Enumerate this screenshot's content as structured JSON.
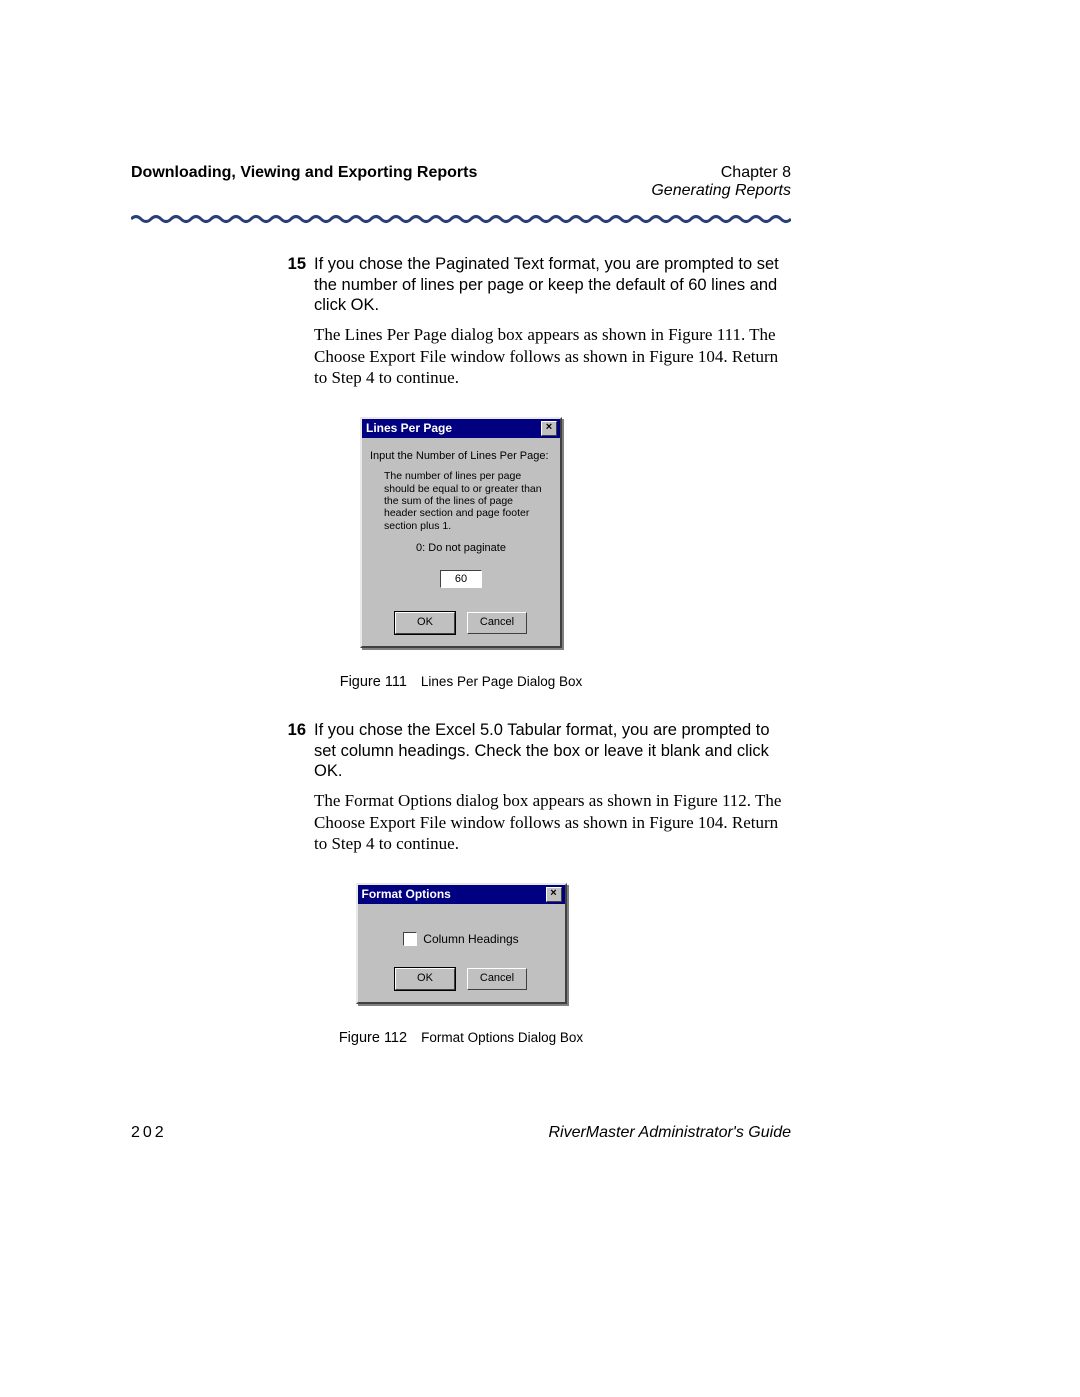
{
  "header": {
    "left": "Downloading, Viewing and Exporting Reports",
    "chapter": "Chapter 8",
    "section": "Generating Reports"
  },
  "step15": {
    "num": "15",
    "text": "If you chose the Paginated Text format, you are prompted to set the number of lines per page or keep the default of 60 lines and click OK.",
    "para": "The Lines Per Page dialog box appears as shown in Figure 111. The Choose Export File window follows as shown in Figure 104. Return to Step 4 to continue."
  },
  "dialog1": {
    "title": "Lines Per Page",
    "close": "×",
    "prompt": "Input the Number of Lines Per Page:",
    "note": "The number of lines per page should be equal to or greater than the sum of the lines of page header section and page footer section plus 1.",
    "nopag": "0: Do not paginate",
    "value": "60",
    "ok": "OK",
    "cancel": "Cancel"
  },
  "caption1": {
    "num": "Figure 111",
    "txt": "Lines Per Page Dialog Box"
  },
  "step16": {
    "num": "16",
    "text": "If you chose the Excel 5.0 Tabular format, you are prompted to set column headings. Check the box or leave it blank and click OK.",
    "para": "The Format Options dialog box appears as shown in Figure 112. The Choose Export File window follows as shown in Figure 104. Return to Step 4 to continue."
  },
  "dialog2": {
    "title": "Format Options",
    "close": "×",
    "check_label": "Column Headings",
    "ok": "OK",
    "cancel": "Cancel"
  },
  "caption2": {
    "num": "Figure 112",
    "txt": "Format Options Dialog Box"
  },
  "footer": {
    "page": "202",
    "guide": "RiverMaster Administrator's Guide"
  }
}
